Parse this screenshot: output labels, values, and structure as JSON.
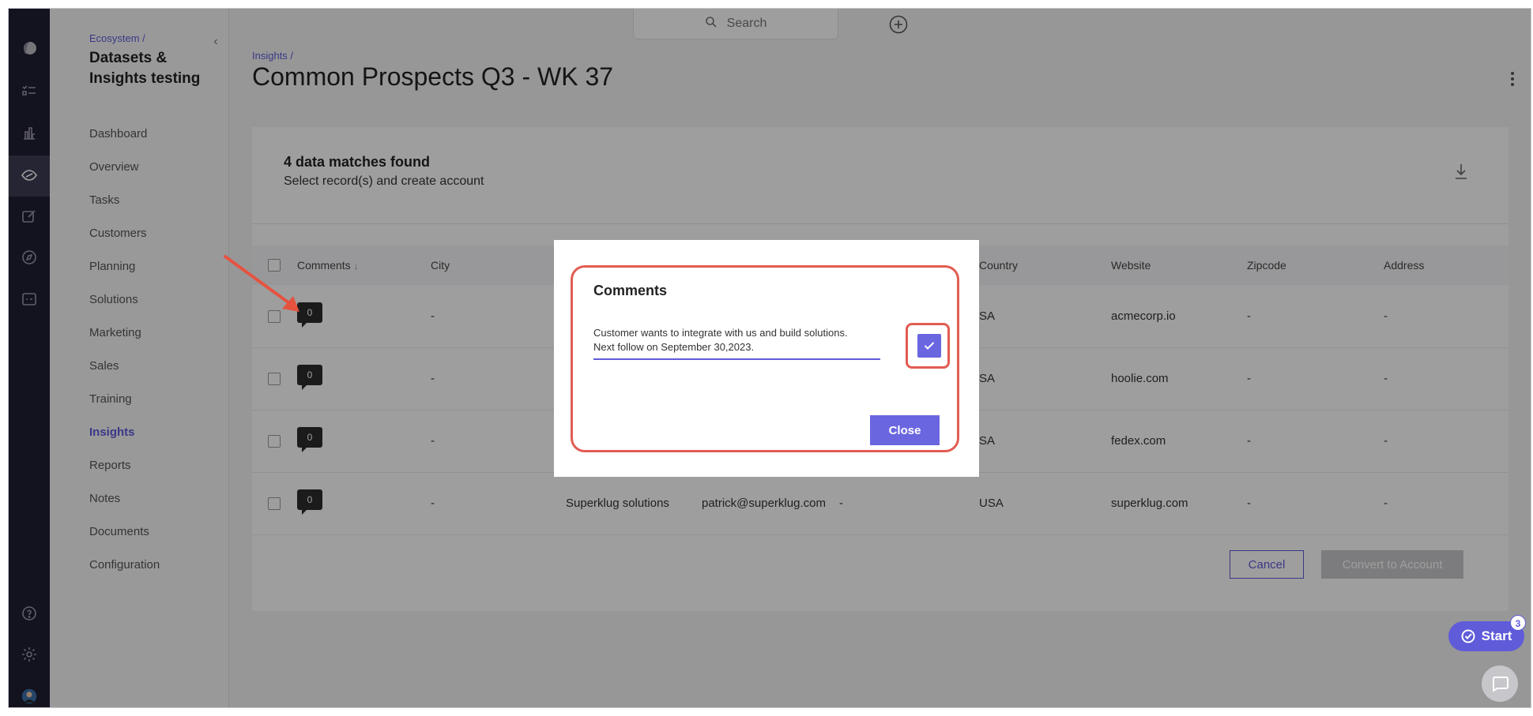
{
  "nav": {
    "breadcrumb": "Ecosystem /",
    "title": "Datasets & Insights testing",
    "items": [
      {
        "label": "Dashboard",
        "active": false
      },
      {
        "label": "Overview",
        "active": false
      },
      {
        "label": "Tasks",
        "active": false
      },
      {
        "label": "Customers",
        "active": false
      },
      {
        "label": "Planning",
        "active": false
      },
      {
        "label": "Solutions",
        "active": false
      },
      {
        "label": "Marketing",
        "active": false
      },
      {
        "label": "Sales",
        "active": false
      },
      {
        "label": "Training",
        "active": false
      },
      {
        "label": "Insights",
        "active": true
      },
      {
        "label": "Reports",
        "active": false
      },
      {
        "label": "Notes",
        "active": false
      },
      {
        "label": "Documents",
        "active": false
      },
      {
        "label": "Configuration",
        "active": false
      }
    ]
  },
  "search": {
    "placeholder": "Search"
  },
  "header": {
    "breadcrumb": "Insights /",
    "title": "Common Prospects Q3 - WK 37"
  },
  "results": {
    "summary": "4 data matches found",
    "subtitle": "Select record(s) and create account"
  },
  "table": {
    "columns": [
      "Comments",
      "City",
      "Country",
      "Website",
      "Zipcode",
      "Address"
    ],
    "sort_indicator": "↓",
    "rows": [
      {
        "comments": "0",
        "city": "-",
        "company": "",
        "email": "",
        "extra": "",
        "country": "SA",
        "website": "acmecorp.io",
        "zipcode": "-",
        "address": "-"
      },
      {
        "comments": "0",
        "city": "-",
        "company": "",
        "email": "",
        "extra": "",
        "country": "SA",
        "website": "hoolie.com",
        "zipcode": "-",
        "address": "-"
      },
      {
        "comments": "0",
        "city": "-",
        "company": "",
        "email": "",
        "extra": "",
        "country": "SA",
        "website": "fedex.com",
        "zipcode": "-",
        "address": "-"
      },
      {
        "comments": "0",
        "city": "-",
        "company": "Superklug solutions",
        "email": "patrick@superklug.com",
        "extra": "-",
        "country": "USA",
        "website": "superklug.com",
        "zipcode": "-",
        "address": "-"
      }
    ]
  },
  "actions": {
    "cancel": "Cancel",
    "convert": "Convert to Account"
  },
  "modal": {
    "title": "Comments",
    "comment_line1": "Customer wants to integrate with us and build solutions.",
    "comment_line2": "Next follow on September 30,2023.",
    "close": "Close"
  },
  "widgets": {
    "start_label": "Start",
    "start_badge": "3"
  },
  "colors": {
    "accent": "#5f5bd9",
    "highlight": "#e25c52",
    "rail": "#1f1d33"
  },
  "icons": [
    "logo-icon",
    "tasks-icon",
    "chart-icon",
    "insights-icon",
    "edit-icon",
    "compass-icon",
    "dataset-icon",
    "help-icon",
    "gear-icon",
    "avatar",
    "search-icon",
    "plus-circle-icon",
    "kebab-icon",
    "download-icon",
    "check-icon",
    "chat-icon",
    "checklist-icon",
    "annotation-arrow"
  ]
}
